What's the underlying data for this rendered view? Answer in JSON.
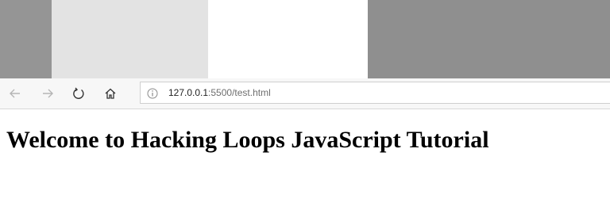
{
  "browser": {
    "url_host": "127.0.0.1",
    "url_rest": ":5500/test.html"
  },
  "icons": {
    "back": "arrow-left-icon",
    "forward": "arrow-right-icon",
    "refresh": "refresh-icon",
    "home": "home-icon",
    "info": "info-icon"
  },
  "page": {
    "heading": "Welcome to Hacking Loops JavaScript Tutorial"
  }
}
